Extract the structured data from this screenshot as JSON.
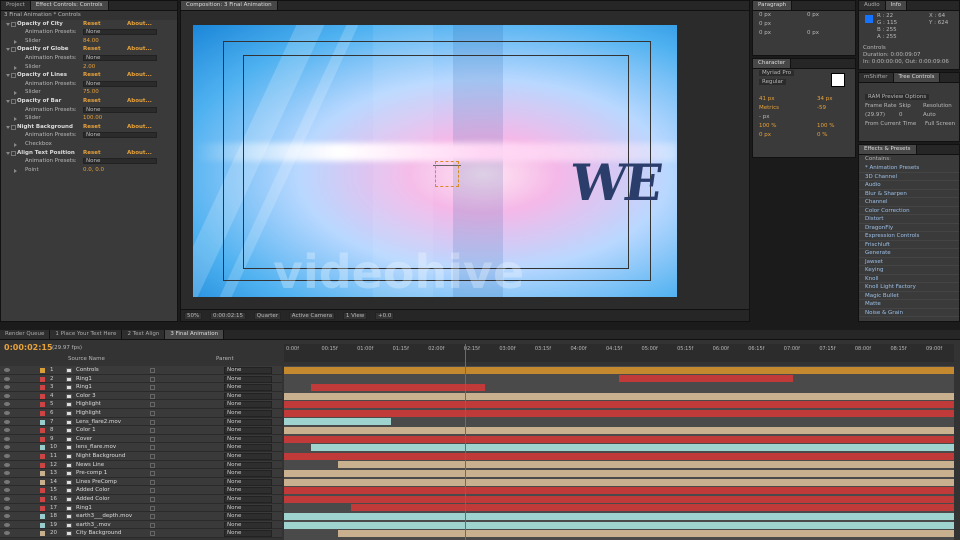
{
  "left_tabs": [
    "Project",
    "Effect Controls: Controls"
  ],
  "ec": {
    "header": "3 Final Animation * Controls",
    "rows": [
      {
        "kind": "prop",
        "label": "Opacity of City",
        "v1": "Reset",
        "v2": "About..."
      },
      {
        "kind": "preset",
        "label": "Animation Presets:",
        "val": "None"
      },
      {
        "kind": "slider",
        "label": "Slider",
        "val": "84.00"
      },
      {
        "kind": "prop",
        "label": "Opacity of Globe",
        "v1": "Reset",
        "v2": "About..."
      },
      {
        "kind": "preset",
        "label": "Animation Presets:",
        "val": "None"
      },
      {
        "kind": "slider",
        "label": "Slider",
        "val": "2.00"
      },
      {
        "kind": "prop",
        "label": "Opacity of Lines",
        "v1": "Reset",
        "v2": "About..."
      },
      {
        "kind": "preset",
        "label": "Animation Presets:",
        "val": "None"
      },
      {
        "kind": "slider",
        "label": "Slider",
        "val": "75.00"
      },
      {
        "kind": "prop",
        "label": "Opacity of Bar",
        "v1": "Reset",
        "v2": "About..."
      },
      {
        "kind": "preset",
        "label": "Animation Presets:",
        "val": "None"
      },
      {
        "kind": "slider",
        "label": "Slider",
        "val": "100.00"
      },
      {
        "kind": "prop",
        "label": "Night Background",
        "v1": "Reset",
        "v2": "About..."
      },
      {
        "kind": "preset",
        "label": "Animation Presets:",
        "val": "None"
      },
      {
        "kind": "slider",
        "label": "Checkbox",
        "val": ""
      },
      {
        "kind": "prop",
        "label": "Align Text Position",
        "v1": "Reset",
        "v2": "About..."
      },
      {
        "kind": "preset",
        "label": "Animation Presets:",
        "val": "None"
      },
      {
        "kind": "slider",
        "label": "Point",
        "val": "0.0, 0.0"
      }
    ]
  },
  "viewer": {
    "tab": "Composition: 3 Final Animation",
    "headline": "WE",
    "watermark": "videohive",
    "controls": [
      "50%",
      "0:00:02:15",
      "Quarter",
      "Active Camera",
      "1 View",
      "+0.0"
    ]
  },
  "right": {
    "paragraph_tab": "Paragraph",
    "audio_tab": "Audio",
    "info_tab": "Info",
    "info": {
      "r": "R : 22",
      "g": "G : 115",
      "b": "B : 255",
      "a": "A : 255",
      "x": "X : 64",
      "y": "Y : 624",
      "name": "Controls",
      "dur": "Duration: 0:00:09:07",
      "inout": "In: 0:00:00:00, Out: 0:00:09:06"
    },
    "para_vals": [
      "0 px",
      "0 px",
      "0 px",
      "0 px",
      "0 px"
    ],
    "character_tab": "Character",
    "font": "Myriad Pro",
    "style": "Regular",
    "char_vals": [
      "41 px",
      "34 px",
      "Metrics",
      "-59",
      "- px",
      "100 %",
      "100 %",
      "0 px",
      "0 %"
    ],
    "mshifter_tab": "mShifter",
    "tree_tab": "Tree Controls",
    "ram": {
      "title": "RAM Preview Options",
      "fr_label": "Frame Rate",
      "skip_label": "Skip",
      "res_label": "Resolution",
      "fr": "(29.97)",
      "skip": "0",
      "res": "Auto",
      "from": "From Current Time",
      "full": "Full Screen"
    },
    "effects_tab": "Effects & Presets",
    "contains": "Contains:",
    "effects": [
      "* Animation Presets",
      "3D Channel",
      "Audio",
      "Blur & Sharpen",
      "Channel",
      "Color Correction",
      "Distort",
      "DragonFly",
      "Expression Controls",
      "Frischluft",
      "Generate",
      "Jawset",
      "Keying",
      "Knoll",
      "Knoll Light Factory",
      "Magic Bullet",
      "Matte",
      "Noise & Grain"
    ]
  },
  "timeline": {
    "tabs": [
      "Render Queue",
      "1 Place Your Text Here",
      "2 Text Align",
      "3 Final Animation"
    ],
    "time": "0:00:02:15",
    "fps": "(29.97 fps)",
    "col_source": "Source Name",
    "col_parent": "Parent",
    "ruler": [
      "0:00f",
      "00:15f",
      "01:00f",
      "01:15f",
      "02:00f",
      "02:15f",
      "03:00f",
      "03:15f",
      "04:00f",
      "04:15f",
      "05:00f",
      "05:15f",
      "06:00f",
      "06:15f",
      "07:00f",
      "07:15f",
      "08:00f",
      "08:15f",
      "09:00f"
    ],
    "layers": [
      {
        "n": "1",
        "name": "Controls",
        "color": "#d9a03a",
        "bar": "#c4892e",
        "s": 0,
        "e": 1
      },
      {
        "n": "2",
        "name": "Ring1",
        "color": "#c44",
        "bar": "#c03a3a",
        "s": 0.5,
        "e": 0.76
      },
      {
        "n": "3",
        "name": "Ring1",
        "color": "#c44",
        "bar": "#c03a3a",
        "s": 0.04,
        "e": 0.3
      },
      {
        "n": "4",
        "name": "Color 3",
        "color": "#c44",
        "bar": "#c9b08f",
        "s": 0,
        "e": 1
      },
      {
        "n": "5",
        "name": "Highlight",
        "color": "#c44",
        "bar": "#c03a3a",
        "s": 0,
        "e": 1
      },
      {
        "n": "6",
        "name": "Highlight",
        "color": "#c44",
        "bar": "#c03a3a",
        "s": 0,
        "e": 1
      },
      {
        "n": "7",
        "name": "Lens_flare2.mov",
        "color": "#9cc",
        "bar": "#9fd3d0",
        "s": 0,
        "e": 0.16
      },
      {
        "n": "8",
        "name": "Color 1",
        "color": "#c44",
        "bar": "#c9b08f",
        "s": 0,
        "e": 1
      },
      {
        "n": "9",
        "name": "Cover",
        "color": "#c44",
        "bar": "#c03a3a",
        "s": 0,
        "e": 1
      },
      {
        "n": "10",
        "name": "lens_flare.mov",
        "color": "#9cc",
        "bar": "#9fd3d0",
        "s": 0.04,
        "e": 1
      },
      {
        "n": "11",
        "name": "Night Background",
        "color": "#c44",
        "bar": "#c03a3a",
        "s": 0,
        "e": 1
      },
      {
        "n": "12",
        "name": "News Line",
        "color": "#c44",
        "bar": "#c9b08f",
        "s": 0.08,
        "e": 1
      },
      {
        "n": "13",
        "name": "Pre-comp 1",
        "color": "#c9b08f",
        "bar": "#c9b08f",
        "s": 0,
        "e": 1
      },
      {
        "n": "14",
        "name": "Lines PreComp",
        "color": "#c9b08f",
        "bar": "#c9b08f",
        "s": 0,
        "e": 1
      },
      {
        "n": "15",
        "name": "Added Color",
        "color": "#c44",
        "bar": "#c03a3a",
        "s": 0,
        "e": 1
      },
      {
        "n": "16",
        "name": "Added Color",
        "color": "#c44",
        "bar": "#c03a3a",
        "s": 0,
        "e": 1
      },
      {
        "n": "17",
        "name": "Ring1",
        "color": "#c44",
        "bar": "#c03a3a",
        "s": 0.1,
        "e": 1
      },
      {
        "n": "18",
        "name": "earth3___depth.mov",
        "color": "#9cc",
        "bar": "#9fd3d0",
        "s": 0,
        "e": 1
      },
      {
        "n": "19",
        "name": "earth3_.mov",
        "color": "#9cc",
        "bar": "#9fd3d0",
        "s": 0,
        "e": 1
      },
      {
        "n": "20",
        "name": "City Background",
        "color": "#c9b08f",
        "bar": "#c9b08f",
        "s": 0.08,
        "e": 1
      }
    ],
    "parent_none": "None",
    "playhead": 0.27
  }
}
